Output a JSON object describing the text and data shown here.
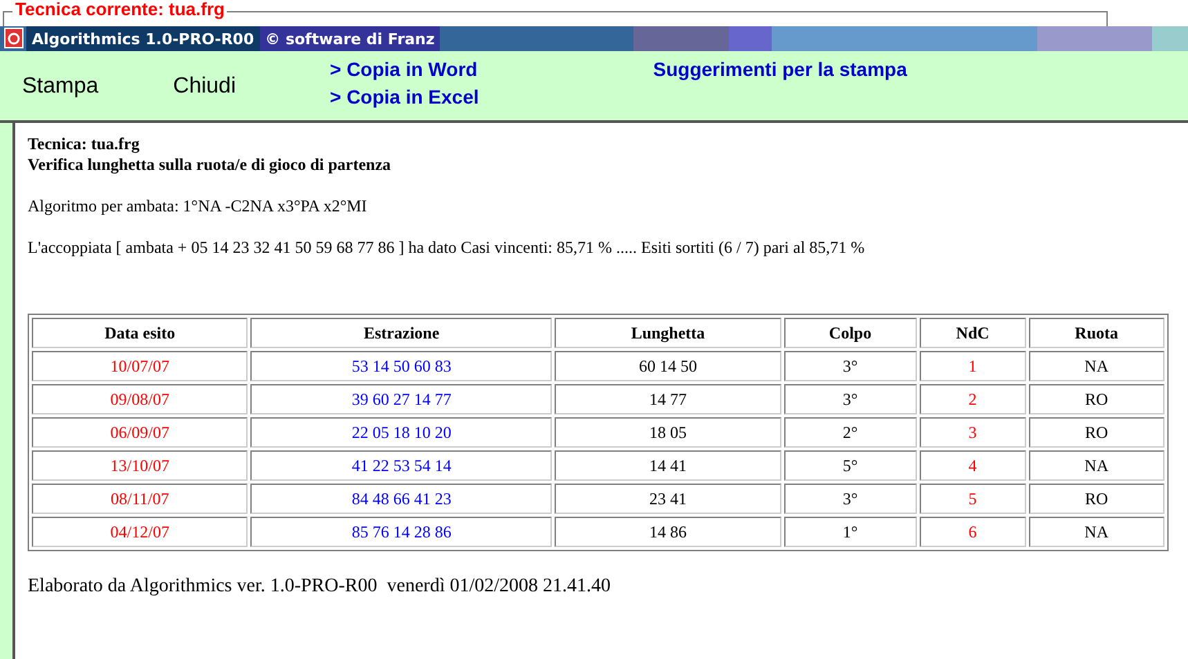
{
  "frame": {
    "legend": "Tecnica corrente: tua.frg"
  },
  "title_bar": {
    "app": "Algorithmics 1.0-PRO-R00",
    "credit": "© software di Franz"
  },
  "toolbar": {
    "buttons": [
      "Stampa",
      "Chiudi"
    ],
    "links": [
      "> Copia in Word",
      "> Copia in Excel"
    ],
    "hint_link": "Suggerimenti per la stampa"
  },
  "report": {
    "heading": [
      "Tecnica: tua.frg",
      "Verifica lunghetta sulla ruota/e di gioco di partenza"
    ],
    "algorithm": "Algoritmo per ambata: 1°NA -C2NA x3°PA x2°MI",
    "summary": "L'accoppiata [ ambata + 05 14 23 32 41 50 59 68 77 86 ] ha dato Casi vincenti: 85,71 % ..... Esiti sortiti (6 / 7) pari al 85,71 %",
    "table": {
      "columns": [
        "Data esito",
        "Estrazione",
        "Lunghetta",
        "Colpo",
        "NdC",
        "Ruota"
      ],
      "rows": [
        [
          "10/07/07",
          "53 14 50 60 83",
          "60 14 50",
          "3°",
          "1",
          "NA"
        ],
        [
          "09/08/07",
          "39 60 27 14 77",
          "14 77",
          "3°",
          "2",
          "RO"
        ],
        [
          "06/09/07",
          "22 05 18 10 20",
          "18 05",
          "2°",
          "3",
          "RO"
        ],
        [
          "13/10/07",
          "41 22 53 54 14",
          "14 41",
          "5°",
          "4",
          "NA"
        ],
        [
          "08/11/07",
          "84 48 66 41 23",
          "23 41",
          "3°",
          "5",
          "RO"
        ],
        [
          "04/12/07",
          "85 76 14 28 86",
          "14 86",
          "1°",
          "6",
          "NA"
        ]
      ]
    },
    "footer": "Elaborato da Algorithmics ver. 1.0-PRO-R00  venerdì 01/02/2008 21.41.40"
  }
}
